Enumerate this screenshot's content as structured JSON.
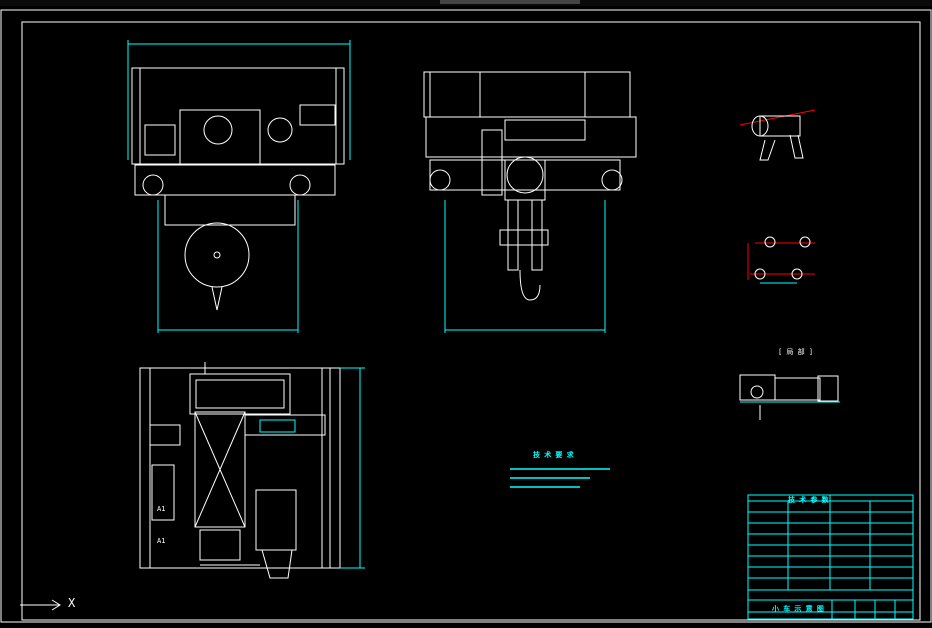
{
  "drawing": {
    "title": "小 车 示 意 图",
    "tech_req_title": "技 术 要 求",
    "table_title": "技 术 参 数",
    "detail_label": "[ 局 部 ]",
    "crane_label_A1": "A1",
    "crane_label_A2": "A1",
    "axis_x_label": "X"
  },
  "colors": {
    "background": "#000000",
    "lines": "#ffffff",
    "dimension": "#00ffff",
    "annotation": "#ffff00",
    "highlight": "#ff0000"
  }
}
